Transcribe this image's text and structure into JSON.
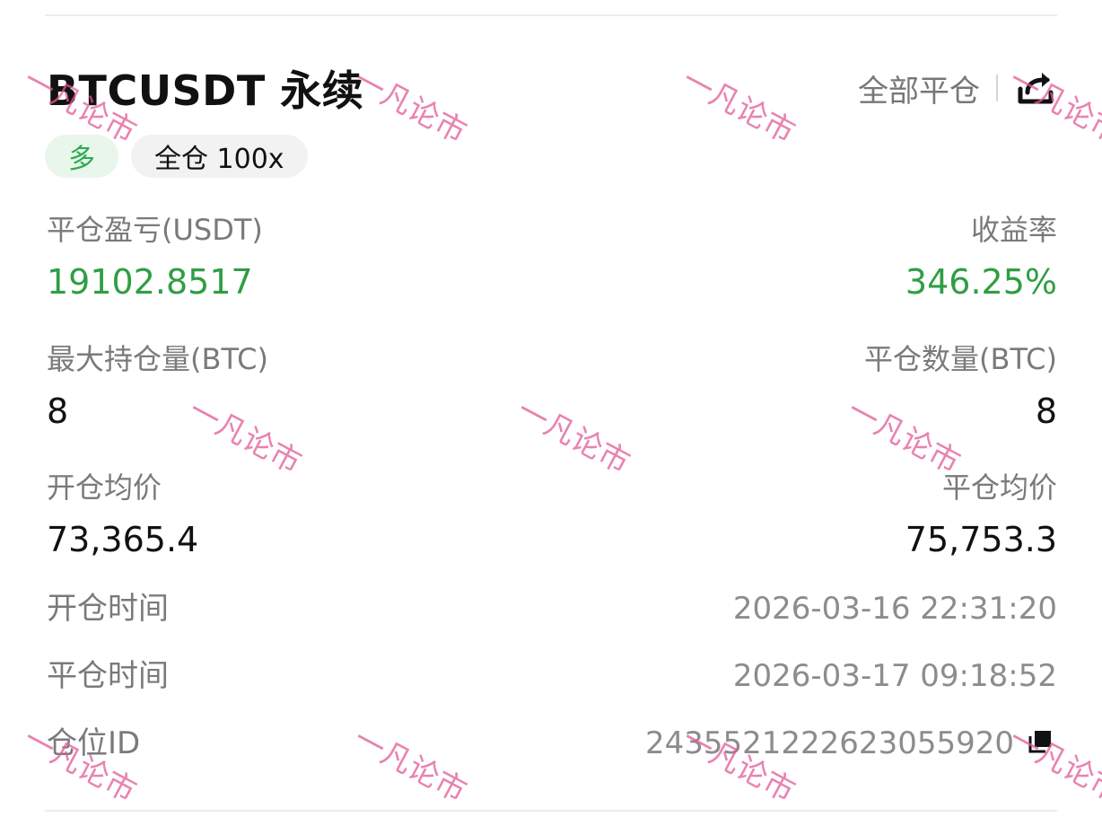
{
  "header": {
    "title": "BTCUSDT 永续",
    "close_all_label": "全部平仓",
    "share_icon": "share-icon"
  },
  "tags": {
    "side": "多",
    "mode": "全仓 100x"
  },
  "stats": {
    "pnl_label": "平仓盈亏(USDT)",
    "pnl_value": "19102.8517",
    "roi_label": "收益率",
    "roi_value": "346.25%",
    "max_pos_label": "最大持仓量(BTC)",
    "max_pos_value": "8",
    "closed_qty_label": "平仓数量(BTC)",
    "closed_qty_value": "8",
    "open_price_label": "开仓均价",
    "open_price_value": "73,365.4",
    "close_price_label": "平仓均价",
    "close_price_value": "75,753.3"
  },
  "details": {
    "open_time_label": "开仓时间",
    "open_time_value": "2026-03-16 22:31:20",
    "close_time_label": "平仓时间",
    "close_time_value": "2026-03-17 09:18:52",
    "position_id_label": "仓位ID",
    "position_id_value": "2435521222623055920"
  },
  "colors": {
    "profit_green": "#2f9e44",
    "long_tag_bg": "#e9f6ec",
    "long_tag_text": "#2bab4e",
    "label_gray": "#7a7a7a",
    "watermark_pink": "#e25a96"
  },
  "watermark_text": "一凡论市"
}
